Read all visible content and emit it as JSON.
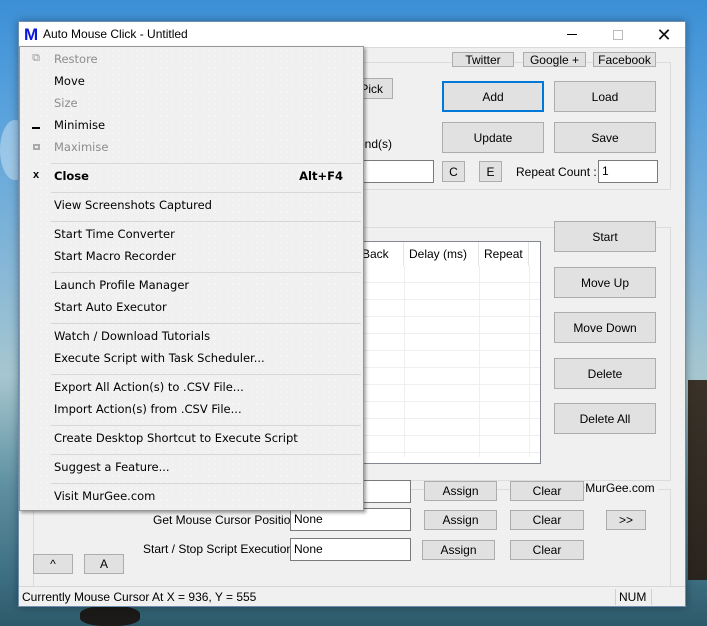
{
  "window": {
    "title": "Auto Mouse Click - Untitled",
    "app_icon_letter": "M",
    "controls": {
      "minimize": "minimize",
      "maximize": "maximize",
      "close": "close"
    }
  },
  "links": {
    "twitter": "Twitter",
    "google": "Google +",
    "facebook": "Facebook"
  },
  "main": {
    "pick_label": "Pick",
    "seconds_partial": "ond(s)",
    "add_label": "Add",
    "load_label": "Load",
    "update_label": "Update",
    "save_label": "Save",
    "c_label": "C",
    "e_label": "E",
    "repeat_count_label": "Repeat Count :",
    "repeat_count_value": "1",
    "partial_input_value": ""
  },
  "table": {
    "columns": [
      "Back",
      "Delay (ms)",
      "Repeat"
    ],
    "rows": []
  },
  "side_buttons": {
    "start": "Start",
    "move_up": "Move Up",
    "move_down": "Move Down",
    "delete": "Delete",
    "delete_all": "Delete All"
  },
  "shortcuts": {
    "group_title": "Support@MurGee.com",
    "rows": [
      {
        "label": "",
        "value": "",
        "assign": "Assign",
        "clear": "Clear"
      },
      {
        "label": "Get Mouse Cursor Position :",
        "value": "None",
        "assign": "Assign",
        "clear": "Clear"
      },
      {
        "label": "Start / Stop Script Execution :",
        "value": "None",
        "assign": "Assign",
        "clear": "Clear"
      }
    ],
    "more_label": ">>",
    "up_label": "^",
    "a_label": "A"
  },
  "status": {
    "text": "Currently Mouse Cursor At X = 936, Y = 555",
    "num": "NUM"
  },
  "system_menu": {
    "items": [
      {
        "label": "Restore",
        "icon": "restore-icon",
        "glyph": "⧉",
        "disabled": true
      },
      {
        "label": "Move",
        "disabled": false
      },
      {
        "label": "Size",
        "disabled": true
      },
      {
        "label": "Minimise",
        "icon": "minimize-icon",
        "glyph": "▁",
        "disabled": false
      },
      {
        "label": "Maximise",
        "icon": "maximize-icon",
        "glyph": "□",
        "disabled": true
      },
      {
        "label": "Close",
        "icon": "close-icon",
        "glyph": "x",
        "shortcut": "Alt+F4",
        "bold": true
      },
      {
        "label": "View Screenshots Captured"
      },
      {
        "label": "Start Time Converter"
      },
      {
        "label": "Start Macro Recorder"
      },
      {
        "label": "Launch Profile Manager"
      },
      {
        "label": "Start Auto Executor"
      },
      {
        "label": "Watch / Download Tutorials"
      },
      {
        "label": "Execute Script with Task Scheduler..."
      },
      {
        "label": "Export All Action(s) to .CSV File..."
      },
      {
        "label": "Import Action(s) from .CSV File..."
      },
      {
        "label": "Create Desktop Shortcut to Execute Script"
      },
      {
        "label": "Suggest a Feature..."
      },
      {
        "label": "Visit MurGee.com"
      }
    ]
  }
}
